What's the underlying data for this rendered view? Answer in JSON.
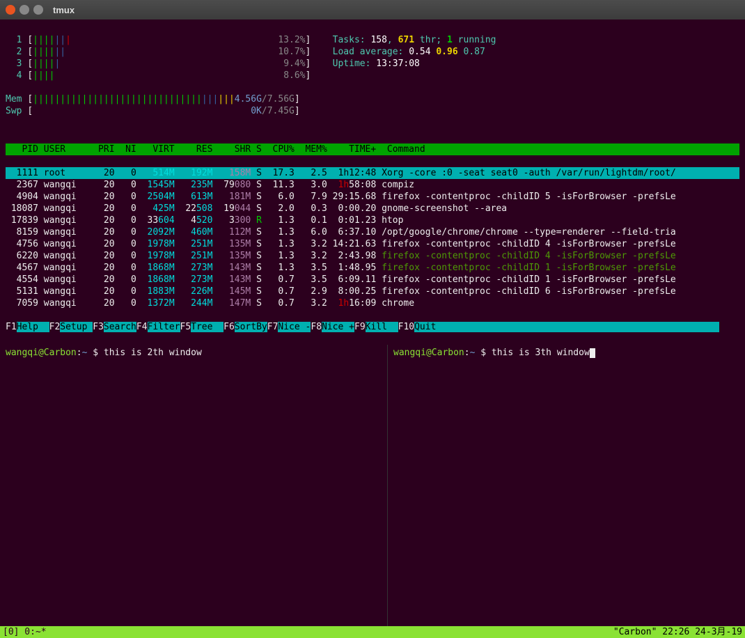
{
  "window": {
    "title": "tmux"
  },
  "cpus": [
    {
      "label": "1",
      "bars": "|||||||",
      "pct": "13.2%"
    },
    {
      "label": "2",
      "bars": "||||||",
      "pct": "10.7%"
    },
    {
      "label": "3",
      "bars": "|||||",
      "pct": "9.4%"
    },
    {
      "label": "4",
      "bars": "||||",
      "pct": "8.6%"
    }
  ],
  "mem": {
    "label": "Mem",
    "used": "4.56G",
    "total": "7.56G"
  },
  "swp": {
    "label": "Swp",
    "used": "0K",
    "total": "7.45G"
  },
  "sys": {
    "tasks_label": "Tasks:",
    "tasks": "158",
    "thr": "671",
    "thr_label": "thr;",
    "running": "1",
    "running_label": "running",
    "load_label": "Load average:",
    "load1": "0.54",
    "load2": "0.96",
    "load3": "0.87",
    "uptime_label": "Uptime:",
    "uptime": "13:37:08"
  },
  "header": {
    "pid": "PID",
    "user": "USER",
    "pri": "PRI",
    "ni": "NI",
    "virt": "VIRT",
    "res": "RES",
    "shr": "SHR",
    "s": "S",
    "cpu": "CPU%",
    "mem": "MEM%",
    "time": "TIME+",
    "cmd": "Command"
  },
  "rows": [
    {
      "pid": "1111",
      "user": "root",
      "pri": "20",
      "ni": "0",
      "virt": "514M",
      "res": "192M",
      "shr": "158M",
      "s": "S",
      "cpu": "17.3",
      "mem": "2.5",
      "time_pre": "1h",
      "time": "12:48",
      "cmd": "Xorg -core :0 -seat seat0 -auth /var/run/lightdm/root/",
      "selected": true
    },
    {
      "pid": "2367",
      "user": "wangqi",
      "pri": "20",
      "ni": "0",
      "virt": "1545M",
      "res": "235M",
      "shr_pre": "79",
      "shr": "080",
      "s": "S",
      "cpu": "11.3",
      "mem": "3.0",
      "time_pre": "1h",
      "time_red": true,
      "time": "58:08",
      "cmd": "compiz"
    },
    {
      "pid": "4904",
      "user": "wangqi",
      "pri": "20",
      "ni": "0",
      "virt": "2504M",
      "res": "613M",
      "shr": "181M",
      "s": "S",
      "cpu": "6.0",
      "mem": "7.9",
      "time": "29:15.68",
      "cmd": "firefox -contentproc -childID 5 -isForBrowser -prefsLe"
    },
    {
      "pid": "18087",
      "user": "wangqi",
      "pri": "20",
      "ni": "0",
      "virt": "425M",
      "res_pre": "22",
      "res": "508",
      "shr_pre": "19",
      "shr": "044",
      "s": "S",
      "cpu": "2.0",
      "mem": "0.3",
      "time": "0:00.20",
      "cmd": "gnome-screenshot --area"
    },
    {
      "pid": "17839",
      "user": "wangqi",
      "pri": "20",
      "ni": "0",
      "virt_pre": "33",
      "virt": "604",
      "res_pre": "4",
      "res": "520",
      "shr_pre": "3",
      "shr": "300",
      "s": "R",
      "s_green": true,
      "cpu": "1.3",
      "mem": "0.1",
      "time": "0:01.23",
      "cmd": "htop"
    },
    {
      "pid": "8159",
      "user": "wangqi",
      "pri": "20",
      "ni": "0",
      "virt": "2092M",
      "res": "460M",
      "shr": "112M",
      "s": "S",
      "cpu": "1.3",
      "mem": "6.0",
      "time": "6:37.10",
      "cmd": "/opt/google/chrome/chrome --type=renderer --field-tria"
    },
    {
      "pid": "4756",
      "user": "wangqi",
      "pri": "20",
      "ni": "0",
      "virt": "1978M",
      "res": "251M",
      "shr": "135M",
      "s": "S",
      "cpu": "1.3",
      "mem": "3.2",
      "time": "14:21.63",
      "cmd": "firefox -contentproc -childID 4 -isForBrowser -prefsLe"
    },
    {
      "pid": "6220",
      "user": "wangqi",
      "pri": "20",
      "ni": "0",
      "virt": "1978M",
      "res": "251M",
      "shr": "135M",
      "s": "S",
      "cpu": "1.3",
      "mem": "3.2",
      "time": "2:43.98",
      "cmd": "firefox -contentproc -childID 4 -isForBrowser -prefsLe",
      "dim": true
    },
    {
      "pid": "4567",
      "user": "wangqi",
      "pri": "20",
      "ni": "0",
      "virt": "1868M",
      "res": "273M",
      "shr": "143M",
      "s": "S",
      "cpu": "1.3",
      "mem": "3.5",
      "time": "1:48.95",
      "cmd": "firefox -contentproc -childID 1 -isForBrowser -prefsLe",
      "dim": true
    },
    {
      "pid": "4554",
      "user": "wangqi",
      "pri": "20",
      "ni": "0",
      "virt": "1868M",
      "res": "273M",
      "shr": "143M",
      "s": "S",
      "cpu": "0.7",
      "mem": "3.5",
      "time": "6:09.11",
      "cmd": "firefox -contentproc -childID 1 -isForBrowser -prefsLe"
    },
    {
      "pid": "5131",
      "user": "wangqi",
      "pri": "20",
      "ni": "0",
      "virt": "1883M",
      "res": "226M",
      "shr": "145M",
      "s": "S",
      "cpu": "0.7",
      "mem": "2.9",
      "time": "8:00.25",
      "cmd": "firefox -contentproc -childID 6 -isForBrowser -prefsLe"
    },
    {
      "pid": "7059",
      "user": "wangqi",
      "pri": "20",
      "ni": "0",
      "virt": "1372M",
      "res": "244M",
      "shr": "147M",
      "s": "S",
      "cpu": "0.7",
      "mem": "3.2",
      "time_pre": "1h",
      "time_red": true,
      "time": "16:09",
      "cmd": "chrome"
    }
  ],
  "fkeys": [
    {
      "n": "F1",
      "lbl": "Help  "
    },
    {
      "n": "F2",
      "lbl": "Setup "
    },
    {
      "n": "F3",
      "lbl": "Search"
    },
    {
      "n": "F4",
      "lbl": "Filter"
    },
    {
      "n": "F5",
      "lbl": "Tree  "
    },
    {
      "n": "F6",
      "lbl": "SortBy"
    },
    {
      "n": "F7",
      "lbl": "Nice -"
    },
    {
      "n": "F8",
      "lbl": "Nice +"
    },
    {
      "n": "F9",
      "lbl": "Kill  "
    },
    {
      "n": "F10",
      "lbl": "Quit  "
    }
  ],
  "panes": {
    "left": {
      "user": "wangqi",
      "host": "Carbon",
      "path": "~",
      "cmd": "this is 2th window"
    },
    "right": {
      "user": "wangqi",
      "host": "Carbon",
      "path": "~",
      "cmd": "this is 3th window"
    }
  },
  "statusbar": {
    "left": "[0] 0:~*",
    "right": "\"Carbon\" 22:26 24-3月-19"
  }
}
